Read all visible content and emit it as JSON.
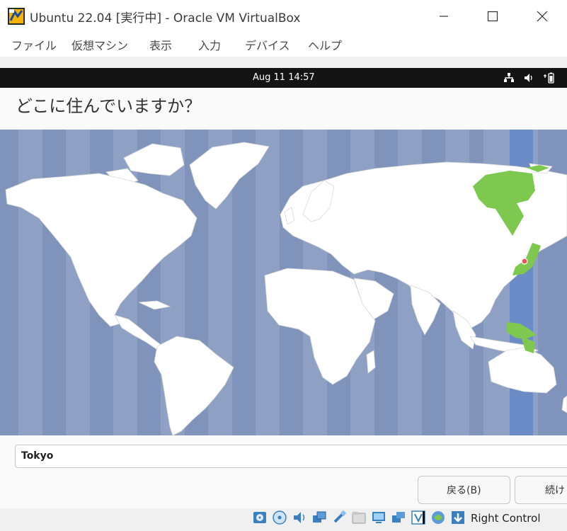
{
  "window": {
    "title": "Ubuntu 22.04 [実行中] - Oracle VM VirtualBox"
  },
  "menu": {
    "items": [
      {
        "label": "ファイル"
      },
      {
        "label": "仮想マシン"
      },
      {
        "label": "表示"
      },
      {
        "label": "入力"
      },
      {
        "label": "デバイス"
      },
      {
        "label": "ヘルプ"
      }
    ]
  },
  "guest": {
    "clock": "Aug 11  14:57",
    "heading": "どこに住んでいますか？",
    "timezone_value": "Tokyo",
    "back_label": "戻る(B)",
    "continue_label": "続け",
    "selected_zone_color": "#7ec850"
  },
  "statusbar": {
    "host_key": "Right Control"
  }
}
